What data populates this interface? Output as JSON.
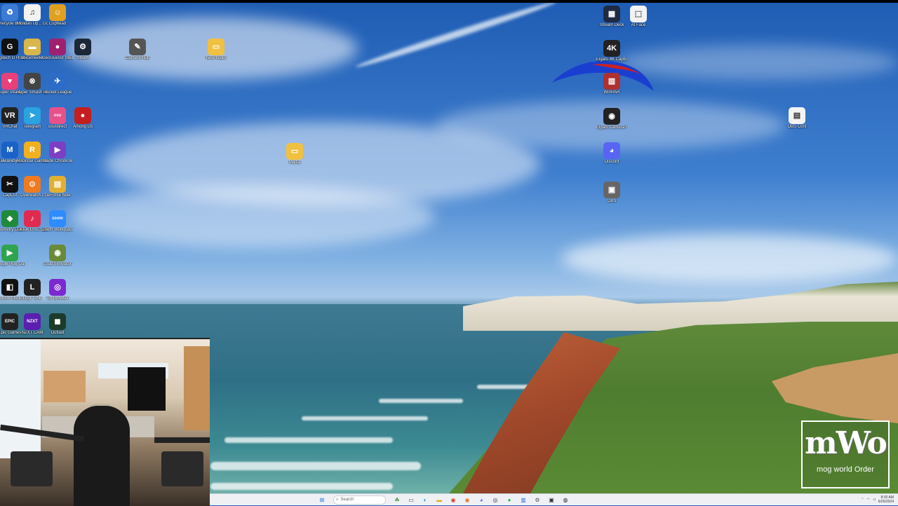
{
  "desktop_icons": [
    {
      "name": "recycle-bin-icon",
      "label": "Recycle Bin",
      "glyph": "♻",
      "color": "#3a7bd5"
    },
    {
      "name": "music-file-icon",
      "label": "Molidan Up... Good Agains",
      "glyph": "♫",
      "color": "#f2f2f2"
    },
    {
      "name": "game-icon",
      "label": "Cuphead",
      "glyph": "☺",
      "color": "#e0a020"
    },
    {
      "name": "logitech-ghub-icon",
      "label": "Logitech G HUB",
      "glyph": "G",
      "color": "#111111"
    },
    {
      "name": "voicemeeter-icon",
      "label": "Voicemeeter",
      "glyph": "▬",
      "color": "#d9b54a"
    },
    {
      "name": "geoguessr-icon",
      "label": "GeoGuessr Steam Ed",
      "glyph": "●",
      "color": "#a02070"
    },
    {
      "name": "steam-icon",
      "label": "Steam",
      "glyph": "⚙",
      "color": "#1b2838"
    },
    {
      "name": "elgato-icon",
      "label": "Camera Hub",
      "glyph": "✎",
      "color": "#555555"
    },
    {
      "name": "folder-icon",
      "label": "New folder",
      "glyph": "▭",
      "color": "#f0c040"
    },
    {
      "name": "streamlabs-icon",
      "label": "Super Vitality",
      "glyph": "♥",
      "color": "#e8407a"
    },
    {
      "name": "epic-launcher-icon",
      "label": "Super Smash Legends",
      "glyph": "⊗",
      "color": "#444444"
    },
    {
      "name": "rocket-league-icon",
      "label": "Rocket League",
      "glyph": "✈",
      "color": "#2b6cc8"
    },
    {
      "name": "vrchat-icon",
      "label": "VRChat",
      "glyph": "VR",
      "color": "#222222"
    },
    {
      "name": "telegram-icon",
      "label": "Telegram",
      "glyph": "➤",
      "color": "#2aa3e0"
    },
    {
      "name": "osu-icon",
      "label": "osu!direct",
      "glyph": "osu",
      "color": "#e8508a"
    },
    {
      "name": "among-us-icon",
      "label": "Among Us",
      "glyph": "●",
      "color": "#c41e1e"
    },
    {
      "name": "malwarebytes-icon",
      "label": "Malwarebytes",
      "glyph": "M",
      "color": "#1a62c8"
    },
    {
      "name": "roblox-studio-icon",
      "label": "Rockstar Games L.",
      "glyph": "R",
      "color": "#f2b01e"
    },
    {
      "name": "clipchamp-icon",
      "label": "Blade Chronicle",
      "glyph": "▶",
      "color": "#7b3fc4"
    },
    {
      "name": "capcut-icon",
      "label": "CapCut",
      "glyph": "✂",
      "color": "#111111"
    },
    {
      "name": "overwatch-icon",
      "label": "Overwatch 2",
      "glyph": "⊙",
      "color": "#f07a20"
    },
    {
      "name": "game-folder-icon",
      "label": "GeForce Now",
      "glyph": "▤",
      "color": "#e0b030"
    },
    {
      "name": "jamaica-flag-icon",
      "label": "Geometry Dash",
      "glyph": "◆",
      "color": "#1f8a3a"
    },
    {
      "name": "tiktok-icon",
      "label": "TikTok LIVE Studio",
      "glyph": "♪",
      "color": "#e02a50"
    },
    {
      "name": "zoom-icon",
      "label": "Zoom Workplace",
      "glyph": "zoom",
      "color": "#2d8cff"
    },
    {
      "name": "google-play-icon",
      "label": "Google Play Games",
      "glyph": "▶",
      "color": "#2ea44f"
    },
    {
      "name": "goat-icon",
      "label": "Goat Simulator",
      "glyph": "◉",
      "color": "#6a8a3a"
    },
    {
      "name": "roblox-icon",
      "label": "Roblox Studio",
      "glyph": "◧",
      "color": "#111111"
    },
    {
      "name": "logi-tune-icon",
      "label": "Logi Tune",
      "glyph": "L",
      "color": "#222222"
    },
    {
      "name": "tor-browser-icon",
      "label": "Tor Browser",
      "glyph": "◎",
      "color": "#7a2ad0"
    },
    {
      "name": "epic-games-icon",
      "label": "Epic Games",
      "glyph": "EPIC",
      "color": "#222222"
    },
    {
      "name": "nzxt-cam-icon",
      "label": "NZXT CAM",
      "glyph": "NZXT",
      "color": "#5a1fb0"
    },
    {
      "name": "outlast-icon",
      "label": "Outlast",
      "glyph": "◼",
      "color": "#1d3b2a"
    },
    {
      "name": "stream-deck-icon",
      "label": "Stream Deck",
      "glyph": "▦",
      "color": "#1f2a44"
    },
    {
      "name": "ai-face-icon",
      "label": "AI Face",
      "glyph": "⬚",
      "color": "#f2f2f2"
    },
    {
      "name": "elgato-4k-capture-icon",
      "label": "Elgato 4K Capture",
      "glyph": "4K",
      "color": "#222222"
    },
    {
      "name": "winrar-icon",
      "label": "WinRAR",
      "glyph": "▥",
      "color": "#b03030"
    },
    {
      "name": "elgato-camera-hub-icon",
      "label": "Elgato Camera Hub",
      "glyph": "◉",
      "color": "#222222"
    },
    {
      "name": "discord-icon",
      "label": "Discord",
      "glyph": "◕",
      "color": "#5865f2"
    },
    {
      "name": "capture-icon",
      "label": "OBS",
      "glyph": "▣",
      "color": "#666666"
    },
    {
      "name": "document-icon",
      "label": "OBS Conf",
      "glyph": "▤",
      "color": "#f4f4f4"
    },
    {
      "name": "media-folder-icon",
      "label": "Media",
      "glyph": "▭",
      "color": "#f0c040"
    }
  ],
  "logo": {
    "big": "mWo",
    "small": "mog world Order"
  },
  "taskbar": {
    "search_placeholder": "Search",
    "apps": [
      {
        "name": "start-button-icon",
        "glyph": "⊞",
        "color": "#1a6fd8"
      },
      {
        "name": "widgets-icon",
        "glyph": "☘",
        "color": "#3a8a3a"
      },
      {
        "name": "task-view-icon",
        "glyph": "▭",
        "color": "#333333"
      },
      {
        "name": "edge-icon",
        "glyph": "◐",
        "color": "#1a8ad8"
      },
      {
        "name": "file-explorer-icon",
        "glyph": "▬",
        "color": "#e0b020"
      },
      {
        "name": "chrome-icon",
        "glyph": "◉",
        "color": "#d83a2a"
      },
      {
        "name": "firefox-icon",
        "glyph": "◉",
        "color": "#e07a20"
      },
      {
        "name": "discord-taskbar-icon",
        "glyph": "◕",
        "color": "#5865f2"
      },
      {
        "name": "obs-taskbar-icon",
        "glyph": "◎",
        "color": "#333333"
      },
      {
        "name": "spotify-icon",
        "glyph": "●",
        "color": "#1db954"
      },
      {
        "name": "store-icon",
        "glyph": "▥",
        "color": "#2a6ad8"
      },
      {
        "name": "settings-icon",
        "glyph": "⚙",
        "color": "#555555"
      },
      {
        "name": "terminal-icon",
        "glyph": "▣",
        "color": "#333333"
      },
      {
        "name": "steam-taskbar-icon",
        "glyph": "◍",
        "color": "#1b2838"
      }
    ],
    "tray": {
      "time": "8:30 AM",
      "date": "6/26/2024"
    }
  }
}
